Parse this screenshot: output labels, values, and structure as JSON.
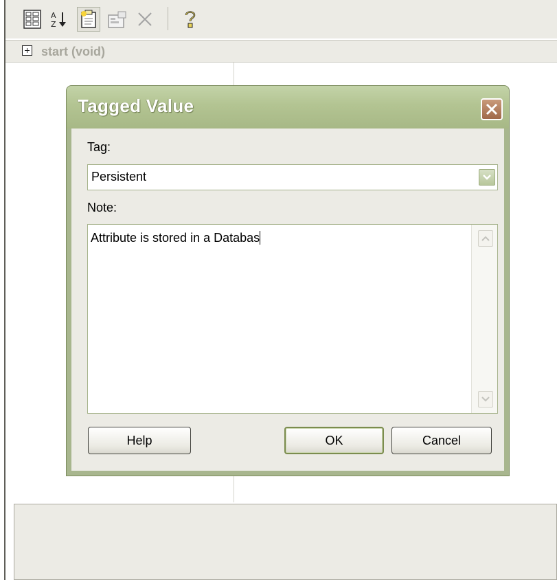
{
  "toolbar": {
    "buttons": [
      {
        "icon": "grid-view-icon"
      },
      {
        "icon": "sort-az-icon"
      },
      {
        "icon": "new-tagged-value-icon",
        "active": true
      },
      {
        "icon": "properties-icon"
      },
      {
        "icon": "delete-icon"
      },
      {
        "icon": "help-icon"
      }
    ]
  },
  "tree": {
    "label": "start (void)"
  },
  "dialog": {
    "title": "Tagged Value",
    "tag_label": "Tag:",
    "tag_value": "Persistent",
    "note_label": "Note:",
    "note_value": "Attribute is stored in a Databas",
    "buttons": {
      "help": "Help",
      "ok": "OK",
      "cancel": "Cancel"
    }
  },
  "colors": {
    "title_bar": "#b3c492",
    "frame": "#a8b68e",
    "face": "#ecebe5",
    "close_button": "#a0694a"
  }
}
